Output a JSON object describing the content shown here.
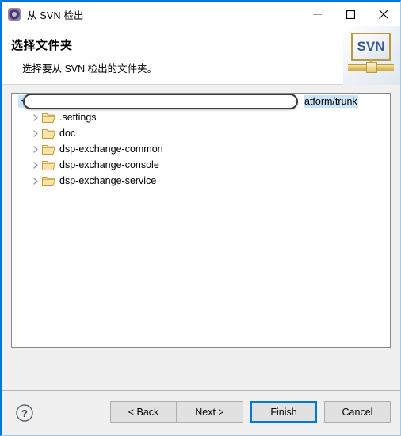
{
  "window": {
    "title": "从 SVN 检出",
    "icon": "svn-repo-icon",
    "accent_color": "#0078d7",
    "controls": {
      "minimize": "minimize-icon",
      "maximize": "maximize-icon",
      "close": "close-icon"
    }
  },
  "banner": {
    "title": "选择文件夹",
    "subtitle": "选择要从 SVN 检出的文件夹。",
    "logo_text": "SVN",
    "logo_name": "svn-logo"
  },
  "tree": {
    "root": {
      "expanded": true,
      "editing": true,
      "edit_value": "",
      "edit_placeholder": "",
      "trailing_text": "atform/trunk",
      "selection_color": "#cce4f7"
    },
    "items": [
      {
        "label": ".settings",
        "icon": "folder-icon",
        "expandable": true
      },
      {
        "label": "doc",
        "icon": "folder-icon",
        "expandable": true
      },
      {
        "label": "dsp-exchange-common",
        "icon": "folder-icon",
        "expandable": true
      },
      {
        "label": "dsp-exchange-console",
        "icon": "folder-icon",
        "expandable": true
      },
      {
        "label": "dsp-exchange-service",
        "icon": "folder-icon",
        "expandable": true
      }
    ]
  },
  "footer": {
    "help": "help-icon",
    "buttons": {
      "back": "< Back",
      "next": "Next >",
      "finish": "Finish",
      "cancel": "Cancel"
    },
    "default_button": "finish"
  }
}
